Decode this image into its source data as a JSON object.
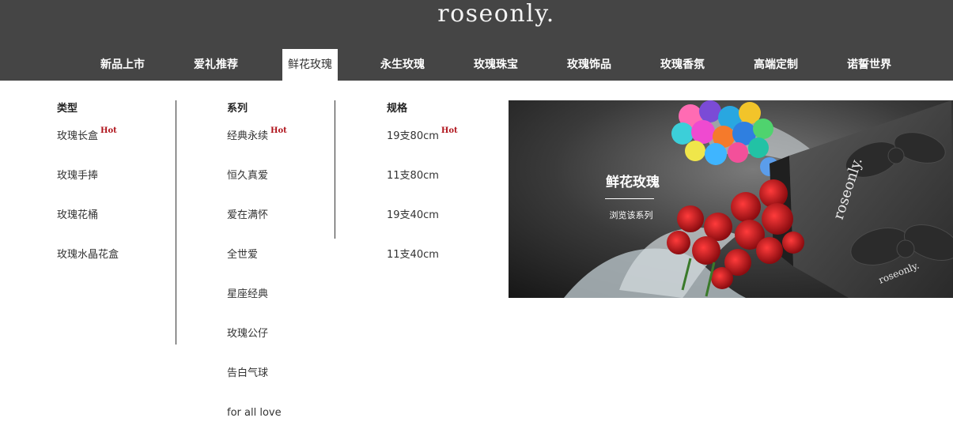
{
  "header": {
    "logo": "roseonly."
  },
  "nav": {
    "items": [
      {
        "label": "新品上市"
      },
      {
        "label": "爱礼推荐"
      },
      {
        "label": "鲜花玫瑰"
      },
      {
        "label": "永生玫瑰"
      },
      {
        "label": "玫瑰珠宝"
      },
      {
        "label": "玫瑰饰品"
      },
      {
        "label": "玫瑰香氛"
      },
      {
        "label": "高端定制"
      },
      {
        "label": "诺誓世界"
      }
    ],
    "active": "鲜花玫瑰"
  },
  "menu": {
    "type": {
      "title": "类型",
      "items": [
        {
          "label": "玫瑰长盒",
          "badge": "Hot"
        },
        {
          "label": "玫瑰手捧"
        },
        {
          "label": "玫瑰花桶"
        },
        {
          "label": "玫瑰水晶花盒"
        }
      ]
    },
    "series": {
      "title": "系列",
      "items": [
        {
          "label": "经典永续",
          "badge": "Hot"
        },
        {
          "label": "恒久真爱"
        },
        {
          "label": "爱在满怀"
        },
        {
          "label": "全世爱"
        },
        {
          "label": "星座经典"
        },
        {
          "label": "玫瑰公仔"
        },
        {
          "label": "告白气球"
        },
        {
          "label": "for all love"
        }
      ]
    },
    "spec": {
      "title": "规格",
      "items": [
        {
          "label": "19支80cm",
          "badge": "Hot"
        },
        {
          "label": "11支80cm"
        },
        {
          "label": "19支40cm"
        },
        {
          "label": "11支40cm"
        }
      ]
    }
  },
  "banner": {
    "title": "鲜花玫瑰",
    "link": "浏览该系列",
    "box_brand": "roseonly."
  },
  "colors": {
    "header_bg": "#454545",
    "hot": "#b0141c",
    "rose_red": "#c4161c"
  }
}
